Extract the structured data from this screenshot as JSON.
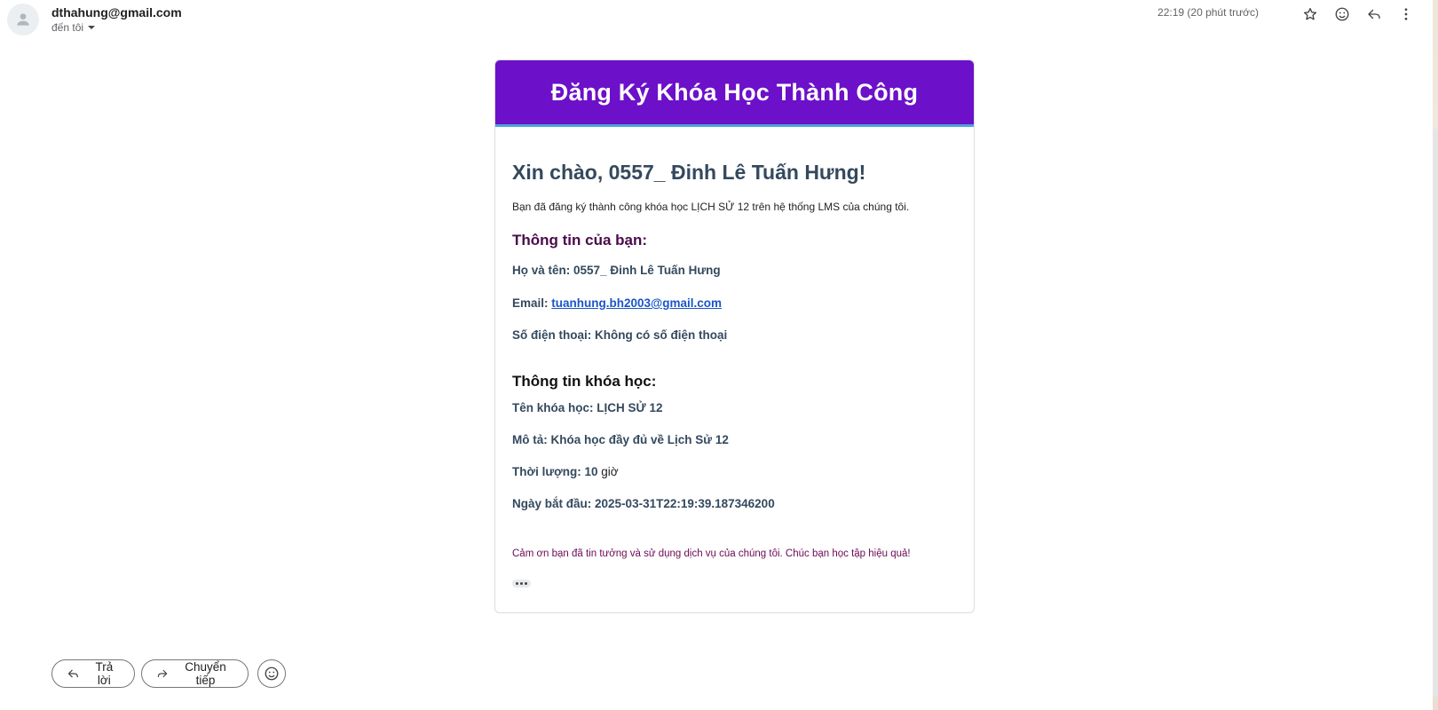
{
  "header": {
    "sender": "dthahung@gmail.com",
    "to_label": "đến tôi",
    "time": "22:19 (20 phút trước)",
    "icons": [
      "star-icon",
      "emoji-icon",
      "reply-icon",
      "more-vert-icon"
    ]
  },
  "email": {
    "title": "Đăng Ký Khóa Học Thành Công",
    "greeting": "Xin chào, 0557_ Đinh Lê Tuấn Hưng!",
    "intro": "Bạn đã đăng ký thành công khóa học LỊCH SỬ 12 trên hệ thống LMS của chúng tôi.",
    "user_info_heading": "Thông tin của bạn:",
    "name_label": "Họ và tên:",
    "name_value": "0557_ Đinh Lê Tuấn Hưng",
    "email_label": "Email:",
    "email_value": "tuanhung.bh2003@gmail.com",
    "phone_label": "Số điện thoại:",
    "phone_value": "Không có số điện thoại",
    "course_heading": "Thông tin khóa học:",
    "course_name_label": "Tên khóa học:",
    "course_name_value": "LỊCH SỬ 12",
    "desc_label": "Mô tả:",
    "desc_value": "Khóa học đầy đủ về Lịch Sử 12",
    "duration_label": "Thời lượng:",
    "duration_value": "10",
    "duration_unit": "giờ",
    "start_label": "Ngày bắt đầu:",
    "start_value": "2025-03-31T22:19:39.187346200",
    "thanks": "Cảm ơn bạn đã tin tưởng và sử dụng dịch vụ của chúng tôi. Chúc bạn học tập hiệu quả!"
  },
  "actions": {
    "reply_label": "Trả lời",
    "forward_label": "Chuyển tiếp"
  },
  "colors": {
    "header_bg": "#6c10c9",
    "header_border": "#4ea3d8",
    "link": "#1a55c8"
  }
}
